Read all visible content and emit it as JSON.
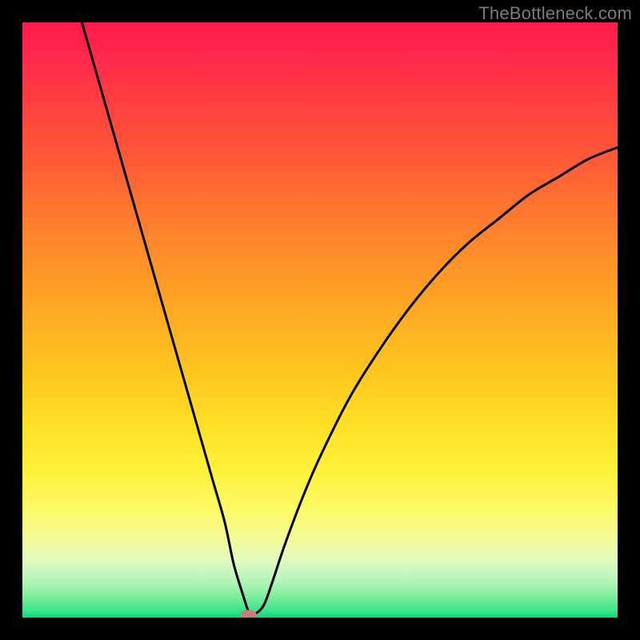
{
  "watermark": {
    "text": "TheBottleneck.com"
  },
  "chart_data": {
    "type": "line",
    "title": "",
    "xlabel": "",
    "ylabel": "",
    "xlim": [
      0,
      100
    ],
    "ylim": [
      0,
      100
    ],
    "grid": false,
    "legend": false,
    "series": [
      {
        "name": "curve",
        "x": [
          10,
          12,
          14,
          16,
          18,
          20,
          22,
          24,
          26,
          28,
          30,
          32,
          34,
          35.5,
          37,
          38,
          38.8,
          40.5,
          42,
          44,
          47,
          50,
          55,
          60,
          65,
          70,
          75,
          80,
          85,
          90,
          95,
          100
        ],
        "y": [
          100,
          93,
          86,
          79,
          72,
          65,
          58,
          51,
          44,
          37,
          30,
          23,
          16,
          9,
          4,
          1,
          0.5,
          2,
          6,
          12,
          20,
          27,
          37,
          45,
          52,
          58,
          63,
          67,
          71,
          74,
          77,
          79
        ]
      }
    ],
    "marker": {
      "x": 38,
      "y": 0.5,
      "color": "#cf7a78"
    },
    "background_gradient": {
      "stops": [
        {
          "pos": 0,
          "color": "#ff1a4b"
        },
        {
          "pos": 0.5,
          "color": "#ffc41f"
        },
        {
          "pos": 0.85,
          "color": "#fdfa68"
        },
        {
          "pos": 1,
          "color": "#00da7c"
        }
      ]
    }
  }
}
